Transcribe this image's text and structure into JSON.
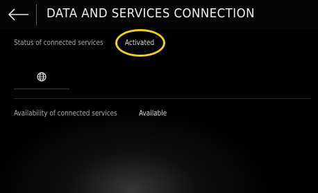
{
  "header": {
    "title": "DATA AND SERVICES CONNECTION",
    "back_icon": "arrow-left-icon"
  },
  "status": {
    "label": "Status of connected services",
    "value": "Activated"
  },
  "language": {
    "icon": "globe-icon"
  },
  "availability": {
    "label": "Availability of connected services",
    "value": "Available"
  },
  "colors": {
    "highlight": "#f2cf1a",
    "background": "#000000",
    "title_text": "#f2f2f2"
  }
}
